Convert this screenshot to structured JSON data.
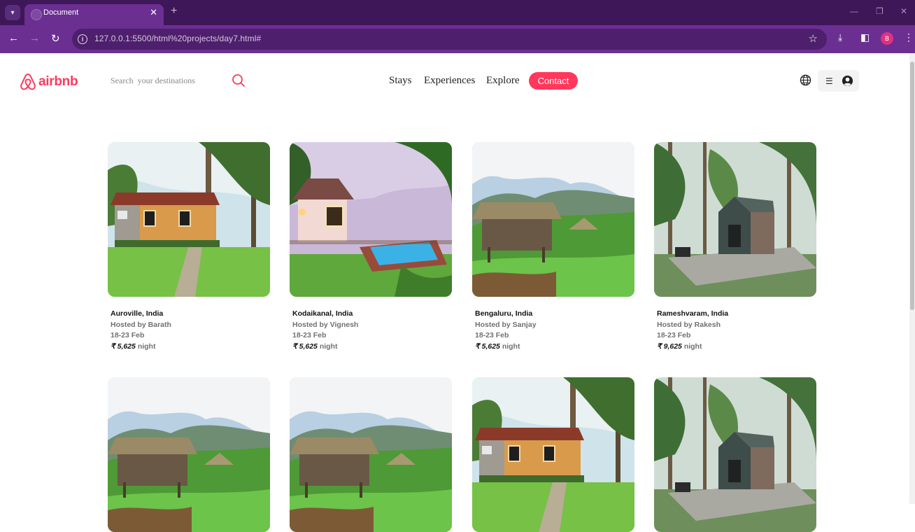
{
  "browser": {
    "tab_title": "Document",
    "url": "127.0.0.1:5500/html%20projects/day7.html#",
    "profile_initial": "B"
  },
  "header": {
    "logo_text": "airbnb",
    "search_placeholder": "Search  your destinations",
    "nav": [
      "Stays",
      "Experiences",
      "Explore"
    ],
    "contact_label": "Contact"
  },
  "listings": [
    {
      "location": "Auroville, India",
      "host": "Hosted by Barath",
      "dates": "18-23 Feb",
      "currency": "₹",
      "price": "5,625",
      "unit": "night",
      "image": "cottage"
    },
    {
      "location": "Kodaikanal, India",
      "host": "Hosted by Vignesh",
      "dates": "18-23 Feb",
      "currency": "₹",
      "price": "5,625",
      "unit": "night",
      "image": "pool-villa"
    },
    {
      "location": "Bengaluru, India",
      "host": "Hosted by Sanjay",
      "dates": "18-23 Feb",
      "currency": "₹",
      "price": "5,625",
      "unit": "night",
      "image": "thatched-hut"
    },
    {
      "location": "Rameshvaram, India",
      "host": "Hosted by Rakesh",
      "dates": "18-23 Feb",
      "currency": "₹",
      "price": "9,625",
      "unit": "night",
      "image": "cabin"
    },
    {
      "image": "thatched-hut"
    },
    {
      "image": "thatched-hut"
    },
    {
      "image": "cottage"
    },
    {
      "image": "cabin"
    }
  ]
}
